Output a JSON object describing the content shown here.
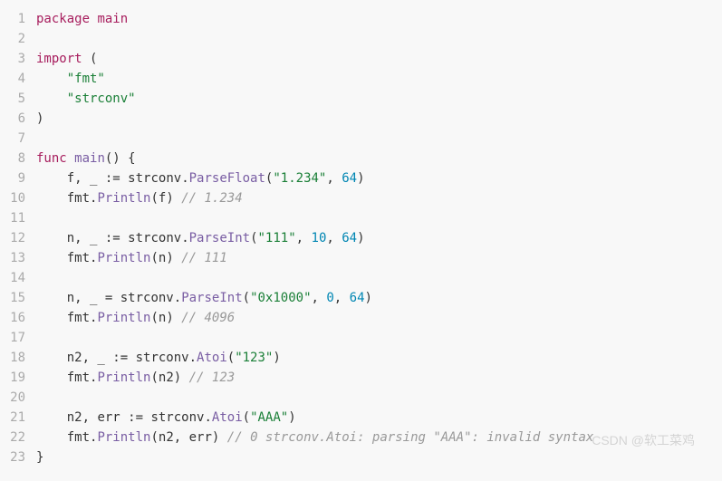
{
  "lines": [
    {
      "num": "1",
      "indent": "",
      "tokens": [
        {
          "cls": "kw",
          "t": "package"
        },
        {
          "cls": "punct",
          "t": " "
        },
        {
          "cls": "pkg",
          "t": "main"
        }
      ]
    },
    {
      "num": "2",
      "indent": "",
      "tokens": []
    },
    {
      "num": "3",
      "indent": "",
      "tokens": [
        {
          "cls": "kw",
          "t": "import"
        },
        {
          "cls": "punct",
          "t": " ("
        }
      ]
    },
    {
      "num": "4",
      "indent": "    ",
      "tokens": [
        {
          "cls": "str",
          "t": "\"fmt\""
        }
      ]
    },
    {
      "num": "5",
      "indent": "    ",
      "tokens": [
        {
          "cls": "str",
          "t": "\"strconv\""
        }
      ]
    },
    {
      "num": "6",
      "indent": "",
      "tokens": [
        {
          "cls": "punct",
          "t": ")"
        }
      ]
    },
    {
      "num": "7",
      "indent": "",
      "tokens": []
    },
    {
      "num": "8",
      "indent": "",
      "tokens": [
        {
          "cls": "kw",
          "t": "func"
        },
        {
          "cls": "punct",
          "t": " "
        },
        {
          "cls": "call",
          "t": "main"
        },
        {
          "cls": "punct",
          "t": "() {"
        }
      ]
    },
    {
      "num": "9",
      "indent": "    ",
      "tokens": [
        {
          "cls": "ident",
          "t": "f"
        },
        {
          "cls": "punct",
          "t": ", _ := "
        },
        {
          "cls": "ident",
          "t": "strconv"
        },
        {
          "cls": "punct",
          "t": "."
        },
        {
          "cls": "call",
          "t": "ParseFloat"
        },
        {
          "cls": "punct",
          "t": "("
        },
        {
          "cls": "str",
          "t": "\"1.234\""
        },
        {
          "cls": "punct",
          "t": ", "
        },
        {
          "cls": "num",
          "t": "64"
        },
        {
          "cls": "punct",
          "t": ")"
        }
      ]
    },
    {
      "num": "10",
      "indent": "    ",
      "tokens": [
        {
          "cls": "ident",
          "t": "fmt"
        },
        {
          "cls": "punct",
          "t": "."
        },
        {
          "cls": "call",
          "t": "Println"
        },
        {
          "cls": "punct",
          "t": "("
        },
        {
          "cls": "ident",
          "t": "f"
        },
        {
          "cls": "punct",
          "t": ") "
        },
        {
          "cls": "comment",
          "t": "// 1.234"
        }
      ]
    },
    {
      "num": "11",
      "indent": "",
      "tokens": []
    },
    {
      "num": "12",
      "indent": "    ",
      "tokens": [
        {
          "cls": "ident",
          "t": "n"
        },
        {
          "cls": "punct",
          "t": ", _ := "
        },
        {
          "cls": "ident",
          "t": "strconv"
        },
        {
          "cls": "punct",
          "t": "."
        },
        {
          "cls": "call",
          "t": "ParseInt"
        },
        {
          "cls": "punct",
          "t": "("
        },
        {
          "cls": "str",
          "t": "\"111\""
        },
        {
          "cls": "punct",
          "t": ", "
        },
        {
          "cls": "num",
          "t": "10"
        },
        {
          "cls": "punct",
          "t": ", "
        },
        {
          "cls": "num",
          "t": "64"
        },
        {
          "cls": "punct",
          "t": ")"
        }
      ]
    },
    {
      "num": "13",
      "indent": "    ",
      "tokens": [
        {
          "cls": "ident",
          "t": "fmt"
        },
        {
          "cls": "punct",
          "t": "."
        },
        {
          "cls": "call",
          "t": "Println"
        },
        {
          "cls": "punct",
          "t": "("
        },
        {
          "cls": "ident",
          "t": "n"
        },
        {
          "cls": "punct",
          "t": ") "
        },
        {
          "cls": "comment",
          "t": "// 111"
        }
      ]
    },
    {
      "num": "14",
      "indent": "",
      "tokens": []
    },
    {
      "num": "15",
      "indent": "    ",
      "tokens": [
        {
          "cls": "ident",
          "t": "n"
        },
        {
          "cls": "punct",
          "t": ", _ = "
        },
        {
          "cls": "ident",
          "t": "strconv"
        },
        {
          "cls": "punct",
          "t": "."
        },
        {
          "cls": "call",
          "t": "ParseInt"
        },
        {
          "cls": "punct",
          "t": "("
        },
        {
          "cls": "str",
          "t": "\"0x1000\""
        },
        {
          "cls": "punct",
          "t": ", "
        },
        {
          "cls": "num",
          "t": "0"
        },
        {
          "cls": "punct",
          "t": ", "
        },
        {
          "cls": "num",
          "t": "64"
        },
        {
          "cls": "punct",
          "t": ")"
        }
      ]
    },
    {
      "num": "16",
      "indent": "    ",
      "tokens": [
        {
          "cls": "ident",
          "t": "fmt"
        },
        {
          "cls": "punct",
          "t": "."
        },
        {
          "cls": "call",
          "t": "Println"
        },
        {
          "cls": "punct",
          "t": "("
        },
        {
          "cls": "ident",
          "t": "n"
        },
        {
          "cls": "punct",
          "t": ") "
        },
        {
          "cls": "comment",
          "t": "// 4096"
        }
      ]
    },
    {
      "num": "17",
      "indent": "",
      "tokens": []
    },
    {
      "num": "18",
      "indent": "    ",
      "tokens": [
        {
          "cls": "ident",
          "t": "n2"
        },
        {
          "cls": "punct",
          "t": ", _ := "
        },
        {
          "cls": "ident",
          "t": "strconv"
        },
        {
          "cls": "punct",
          "t": "."
        },
        {
          "cls": "call",
          "t": "Atoi"
        },
        {
          "cls": "punct",
          "t": "("
        },
        {
          "cls": "str",
          "t": "\"123\""
        },
        {
          "cls": "punct",
          "t": ")"
        }
      ]
    },
    {
      "num": "19",
      "indent": "    ",
      "tokens": [
        {
          "cls": "ident",
          "t": "fmt"
        },
        {
          "cls": "punct",
          "t": "."
        },
        {
          "cls": "call",
          "t": "Println"
        },
        {
          "cls": "punct",
          "t": "("
        },
        {
          "cls": "ident",
          "t": "n2"
        },
        {
          "cls": "punct",
          "t": ") "
        },
        {
          "cls": "comment",
          "t": "// 123"
        }
      ]
    },
    {
      "num": "20",
      "indent": "",
      "tokens": []
    },
    {
      "num": "21",
      "indent": "    ",
      "tokens": [
        {
          "cls": "ident",
          "t": "n2"
        },
        {
          "cls": "punct",
          "t": ", "
        },
        {
          "cls": "ident",
          "t": "err"
        },
        {
          "cls": "punct",
          "t": " := "
        },
        {
          "cls": "ident",
          "t": "strconv"
        },
        {
          "cls": "punct",
          "t": "."
        },
        {
          "cls": "call",
          "t": "Atoi"
        },
        {
          "cls": "punct",
          "t": "("
        },
        {
          "cls": "str",
          "t": "\"AAA\""
        },
        {
          "cls": "punct",
          "t": ")"
        }
      ]
    },
    {
      "num": "22",
      "indent": "    ",
      "tokens": [
        {
          "cls": "ident",
          "t": "fmt"
        },
        {
          "cls": "punct",
          "t": "."
        },
        {
          "cls": "call",
          "t": "Println"
        },
        {
          "cls": "punct",
          "t": "("
        },
        {
          "cls": "ident",
          "t": "n2"
        },
        {
          "cls": "punct",
          "t": ", "
        },
        {
          "cls": "ident",
          "t": "err"
        },
        {
          "cls": "punct",
          "t": ") "
        },
        {
          "cls": "comment",
          "t": "// 0 strconv.Atoi: parsing \"AAA\": invalid syntax"
        }
      ]
    },
    {
      "num": "23",
      "indent": "",
      "tokens": [
        {
          "cls": "punct",
          "t": "}"
        }
      ]
    }
  ],
  "watermark": "CSDN @软工菜鸡"
}
